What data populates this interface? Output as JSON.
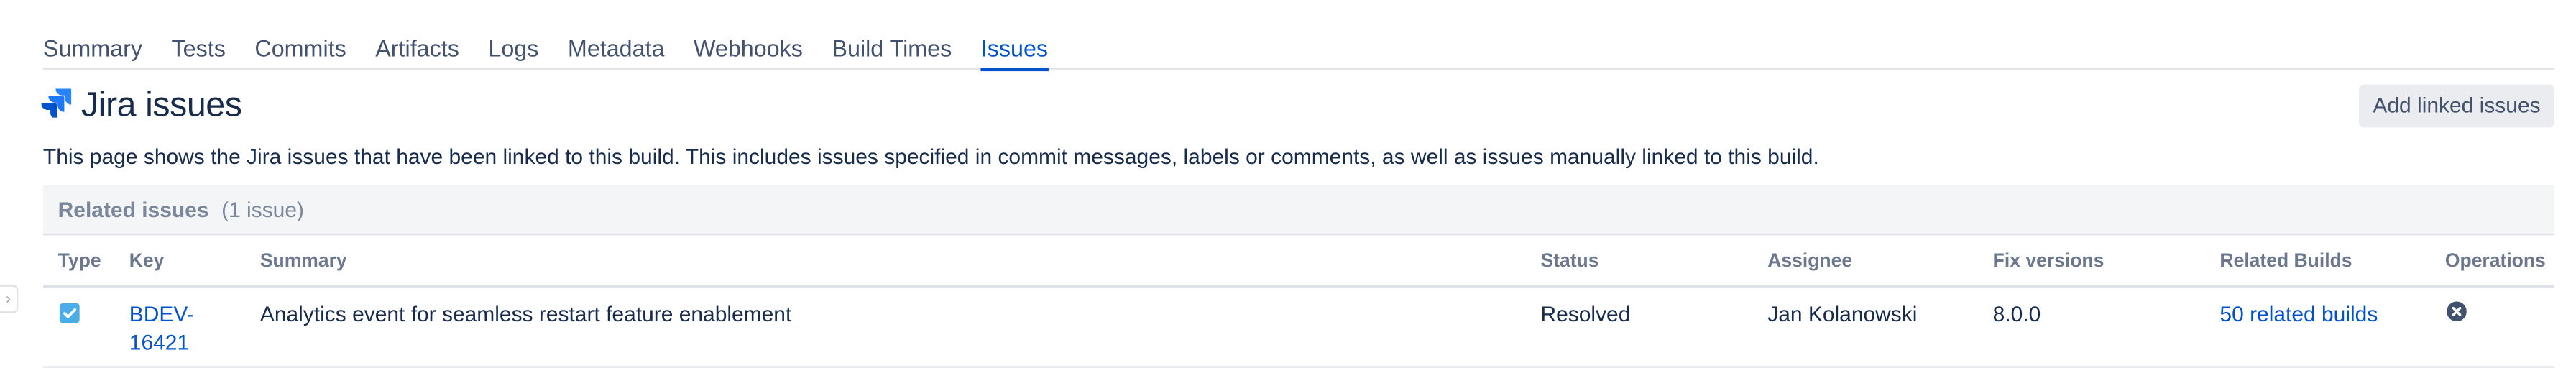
{
  "tabs": [
    {
      "label": "Summary",
      "active": false
    },
    {
      "label": "Tests",
      "active": false
    },
    {
      "label": "Commits",
      "active": false
    },
    {
      "label": "Artifacts",
      "active": false
    },
    {
      "label": "Logs",
      "active": false
    },
    {
      "label": "Metadata",
      "active": false
    },
    {
      "label": "Webhooks",
      "active": false
    },
    {
      "label": "Build Times",
      "active": false
    },
    {
      "label": "Issues",
      "active": true
    }
  ],
  "header": {
    "title": "Jira issues",
    "logo_icon": "jira-icon",
    "add_button_label": "Add linked issues"
  },
  "description": "This page shows the Jira issues that have been linked to this build. This includes issues specified in commit messages, labels or comments, as well as issues manually linked to this build.",
  "related": {
    "title": "Related issues",
    "count": "(1 issue)"
  },
  "table": {
    "columns": [
      "Type",
      "Key",
      "Summary",
      "Status",
      "Assignee",
      "Fix versions",
      "Related Builds",
      "Operations"
    ],
    "rows": [
      {
        "type_icon": "task-checkbox-icon",
        "key": "BDEV-16421",
        "summary": "Analytics event for seamless restart feature enablement",
        "status": "Resolved",
        "assignee": "Jan Kolanowski",
        "fix_versions": "8.0.0",
        "related_builds": "50 related builds",
        "operation_icon": "remove-icon"
      }
    ]
  },
  "colors": {
    "accent": "#0052cc",
    "text": "#172b4d",
    "muted": "#6b778c",
    "section_bg": "#f4f5f7",
    "task_icon": "#4bade8",
    "jira_logo": "#2684ff"
  }
}
